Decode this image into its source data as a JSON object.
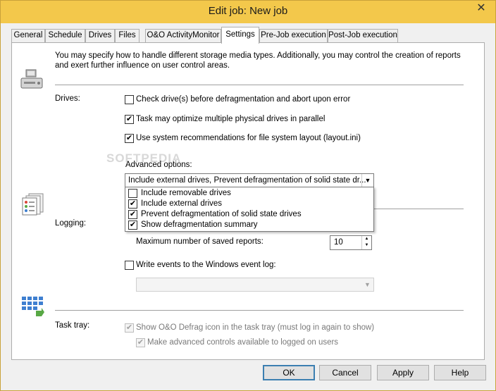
{
  "window": {
    "title": "Edit job: New job",
    "close_glyph": "✕"
  },
  "tabs": [
    {
      "label": "General"
    },
    {
      "label": "Schedule"
    },
    {
      "label": "Drives"
    },
    {
      "label": "Files"
    },
    {
      "label": "O&O ActivityMonitor"
    },
    {
      "label": "Settings"
    },
    {
      "label": "Pre-Job execution"
    },
    {
      "label": "Post-Job execution"
    }
  ],
  "active_tab": "Settings",
  "intro": "You may specify how to handle different storage media types. Additionally, you may control the creation of reports and exert further influence on user control areas.",
  "drives": {
    "section_label": "Drives:",
    "check_before": {
      "label": "Check drive(s) before defragmentation and abort upon error",
      "checked": false
    },
    "optimize_parallel": {
      "label": "Task may optimize multiple physical drives in parallel",
      "checked": true
    },
    "system_recommendations": {
      "label": "Use system recommendations for file system layout (layout.ini)",
      "checked": true
    },
    "advanced_label": "Advanced options:",
    "advanced_value": "Include external drives, Prevent defragmentation of solid state dr...",
    "advanced_items": [
      {
        "label": "Include removable drives",
        "checked": false
      },
      {
        "label": "Include external drives",
        "checked": true
      },
      {
        "label": "Prevent defragmentation of solid state drives",
        "checked": true
      },
      {
        "label": "Show defragmentation summary",
        "checked": true
      }
    ]
  },
  "logging": {
    "section_label": "Logging:",
    "max_reports_label": "Maximum number of saved reports:",
    "max_reports_value": "10",
    "event_log": {
      "label": "Write events to the Windows event log:",
      "checked": false
    },
    "event_log_select_value": ""
  },
  "tray": {
    "section_label": "Task tray:",
    "show_icon": {
      "label": "Show O&O Defrag icon in the task tray (must log in again to show)",
      "checked": true,
      "disabled": true
    },
    "advanced_controls": {
      "label": "Make advanced controls available to logged on users",
      "checked": true,
      "disabled": true
    }
  },
  "buttons": {
    "ok": "OK",
    "cancel": "Cancel",
    "apply": "Apply",
    "help": "Help"
  },
  "watermark": "SOFTPEDIA",
  "icons": {
    "drives": "computer-drive-icon",
    "logging": "report-pages-icon",
    "tray": "grid-tray-icon"
  },
  "colors": {
    "titlebar": "#f3c84b",
    "window_bg": "#f0f0f0",
    "default_button_border": "#3c7fb1"
  }
}
